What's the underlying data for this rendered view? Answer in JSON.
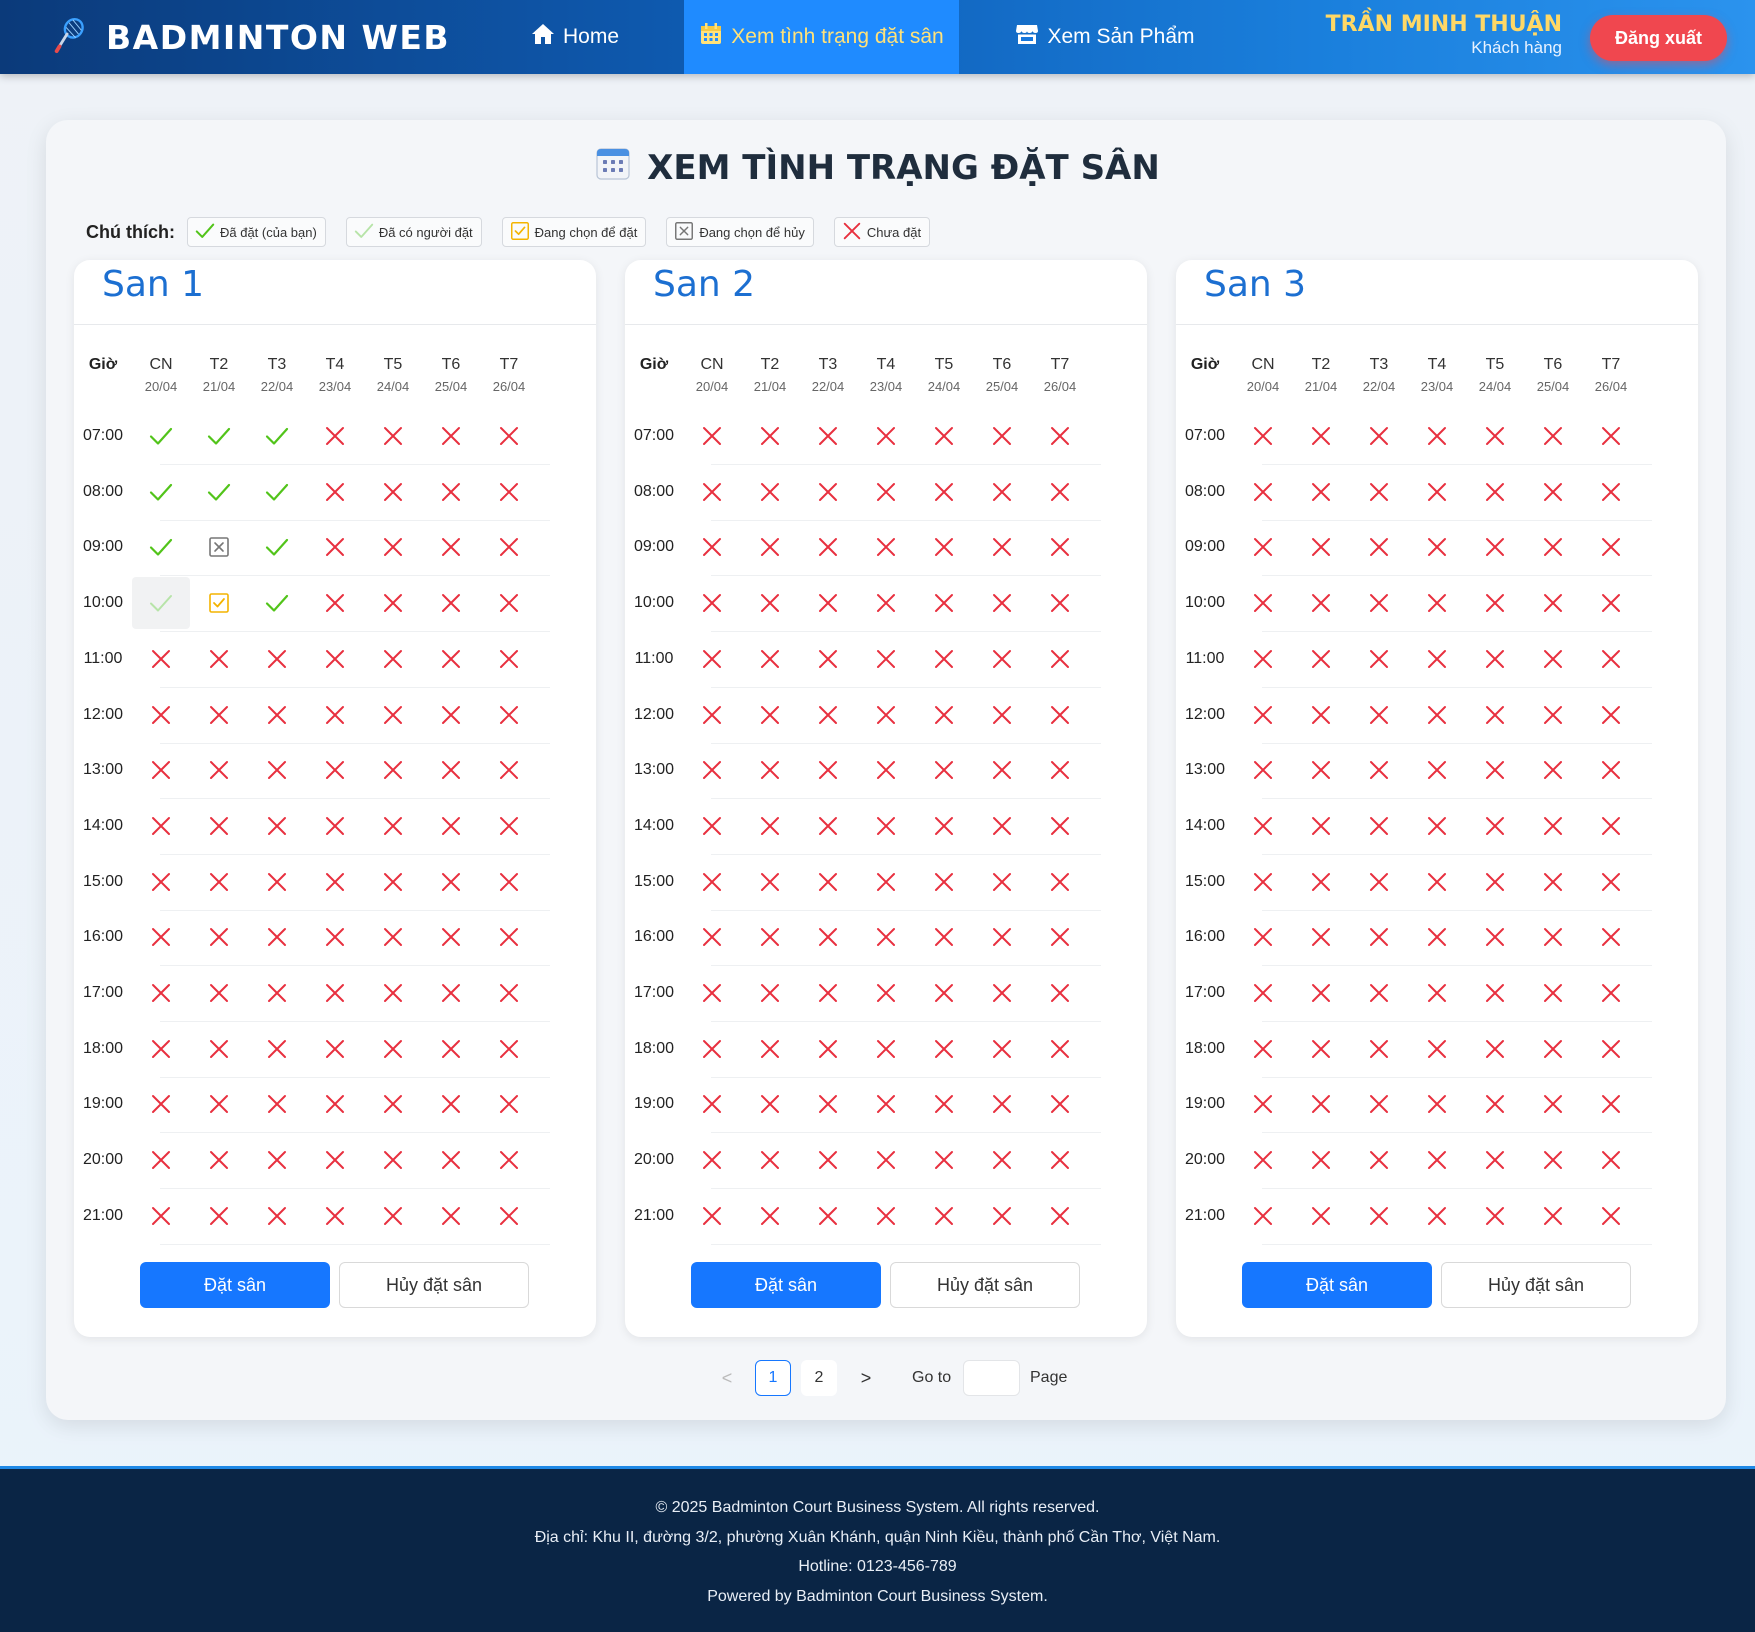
{
  "nav": {
    "brand": "BADMINTON WEB",
    "items": [
      {
        "label": "Home",
        "icon": "home-icon"
      },
      {
        "label": "Xem tình trạng đặt sân",
        "icon": "calendar-icon",
        "active": true
      },
      {
        "label": "Xem Sản Phẩm",
        "icon": "store-icon"
      }
    ],
    "user_name": "TRẦN MINH THUẬN",
    "user_role": "Khách hàng",
    "logout_label": "Đăng xuất"
  },
  "page": {
    "title": "XEM TÌNH TRẠNG ĐẶT SÂN",
    "legend_label": "Chú thích:",
    "legend": [
      {
        "status": "mine",
        "label": "Đã đặt (của bạn)"
      },
      {
        "status": "other",
        "label": "Đã có người đặt"
      },
      {
        "status": "select-book",
        "label": "Đang chọn để đặt"
      },
      {
        "status": "select-cancel",
        "label": "Đang chọn để hủy"
      },
      {
        "status": "free",
        "label": "Chưa đặt"
      }
    ]
  },
  "schedule": {
    "time_header": "Giờ",
    "days": [
      {
        "dow": "CN",
        "date": "20/04"
      },
      {
        "dow": "T2",
        "date": "21/04"
      },
      {
        "dow": "T3",
        "date": "22/04"
      },
      {
        "dow": "T4",
        "date": "23/04"
      },
      {
        "dow": "T5",
        "date": "24/04"
      },
      {
        "dow": "T6",
        "date": "25/04"
      },
      {
        "dow": "T7",
        "date": "26/04"
      }
    ],
    "times": [
      "07:00",
      "08:00",
      "09:00",
      "10:00",
      "11:00",
      "12:00",
      "13:00",
      "14:00",
      "15:00",
      "16:00",
      "17:00",
      "18:00",
      "19:00",
      "20:00",
      "21:00"
    ],
    "courts": [
      {
        "name": "San 1",
        "book_label": "Đặt sân",
        "cancel_label": "Hủy đặt sân",
        "bookings": {
          "07:00": {
            "0": "mine",
            "1": "mine",
            "2": "mine"
          },
          "08:00": {
            "0": "mine",
            "1": "mine",
            "2": "mine"
          },
          "09:00": {
            "0": "mine",
            "1": "select-cancel",
            "2": "mine"
          },
          "10:00": {
            "0": "other",
            "1": "select-book",
            "2": "mine"
          }
        }
      },
      {
        "name": "San 2",
        "book_label": "Đặt sân",
        "cancel_label": "Hủy đặt sân",
        "bookings": {}
      },
      {
        "name": "San 3",
        "book_label": "Đặt sân",
        "cancel_label": "Hủy đặt sân",
        "bookings": {}
      }
    ]
  },
  "pagination": {
    "prev": "<",
    "pages": [
      "1",
      "2"
    ],
    "current": "1",
    "next": ">",
    "goto_label": "Go to",
    "page_label": "Page"
  },
  "footer": {
    "lines": [
      "© 2025 Badminton Court Business System. All rights reserved.",
      "Địa chỉ: Khu II, đường 3/2, phường Xuân Khánh, quận Ninh Kiều, thành phố Cần Thơ, Việt Nam.",
      "Hotline: 0123-456-789",
      "Powered by Badminton Court Business System."
    ]
  },
  "colors": {
    "mine": "#52c41a",
    "other": "#b7e4a8",
    "select_book": "#f4b400",
    "select_cancel": "#777777",
    "free": "#e8303f",
    "accent": "#1677ff"
  }
}
